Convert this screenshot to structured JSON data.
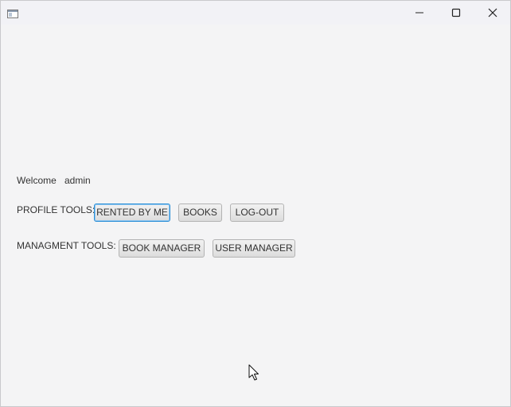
{
  "window": {
    "title": ""
  },
  "welcome": {
    "prefix": "Welcome",
    "username": "admin"
  },
  "profile_tools": {
    "label": "PROFILE TOOLS:",
    "buttons": [
      "RENTED BY ME",
      "BOOKS",
      "LOG-OUT"
    ]
  },
  "managment_tools": {
    "label": "MANAGMENT TOOLS:",
    "buttons": [
      "BOOK MANAGER",
      "USER MANAGER"
    ]
  },
  "colors": {
    "focus_border": "#2b8fd7",
    "background": "#f4f4f5"
  },
  "icons": [
    "app-window-icon",
    "minimize-icon",
    "maximize-icon",
    "close-icon",
    "mouse-cursor-icon"
  ]
}
